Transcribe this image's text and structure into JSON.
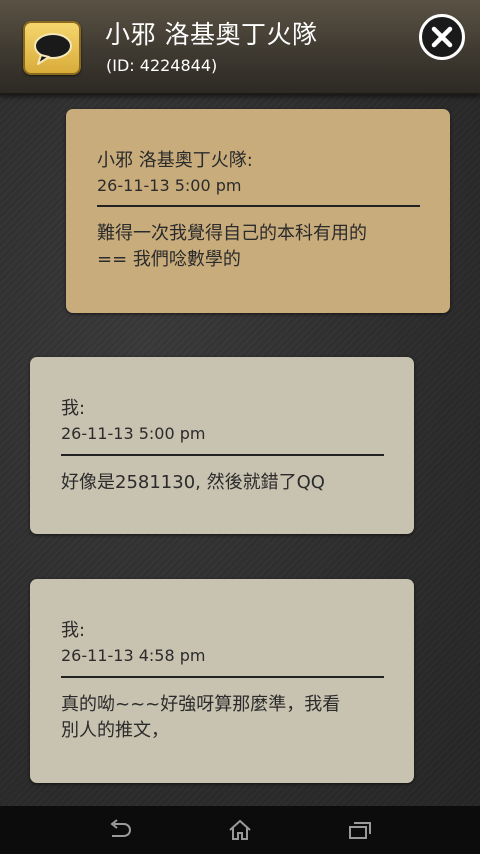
{
  "header": {
    "title": "小邪 洛基奧丁火隊",
    "subtitle": "(ID: 4224844)",
    "logo_icon": "speech-bubble-icon",
    "close_icon": "close-icon"
  },
  "messages": [
    {
      "direction": "incoming",
      "sender": "小邪 洛基奧丁火隊:",
      "time": "26-11-13 5:00 pm",
      "lines": [
        "難得一次我覺得自己的本科有用的",
        "== 我們唸數學的"
      ]
    },
    {
      "direction": "outgoing",
      "sender": "我:",
      "time": "26-11-13 5:00 pm",
      "lines": [
        "好像是2581130, 然後就錯了QQ"
      ]
    },
    {
      "direction": "outgoing",
      "sender": "我:",
      "time": "26-11-13 4:58 pm",
      "lines": [
        "真的呦~~~好強呀算那麼準，我看",
        "別人的推文，"
      ]
    }
  ],
  "navbar": {
    "back_icon": "back-icon",
    "home_icon": "home-icon",
    "recents_icon": "recent-apps-icon"
  },
  "colors": {
    "incoming_bubble": "#c9ac7c",
    "outgoing_bubble": "#c8c2b0",
    "logo_gold": "#e8c24e"
  }
}
